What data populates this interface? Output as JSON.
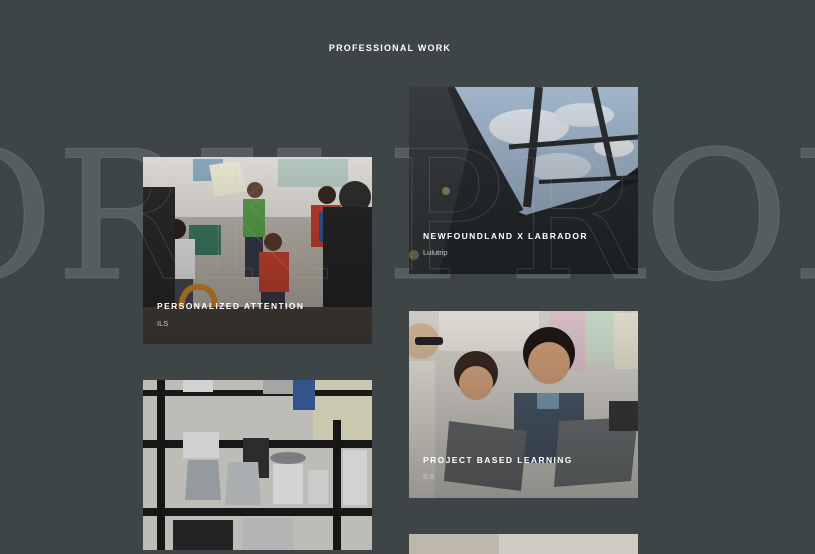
{
  "section": {
    "title": "PROFESSIONAL WORK",
    "background_word": "PROFESSIONAL WORK"
  },
  "cards": [
    {
      "title": "PERSONALIZED ATTENTION",
      "subtitle": "ILS"
    },
    {
      "title": "NEWFOUNDLAND X LABRADOR",
      "subtitle": "Lulutrip"
    },
    {
      "title": "",
      "subtitle": ""
    },
    {
      "title": "PROJECT BASED LEARNING",
      "subtitle": "ILS"
    }
  ],
  "colors": {
    "background": "#3d4547",
    "caption_text": "#ffffff",
    "subtitle_text": "#c9cccc"
  }
}
